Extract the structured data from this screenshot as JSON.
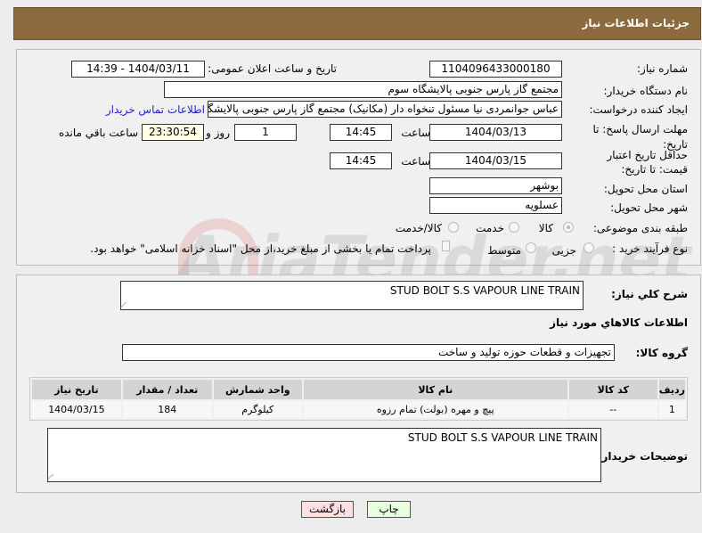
{
  "header": {
    "title": "جزئیات اطلاعات نیاز"
  },
  "form": {
    "need_number_label": "شماره نیاز:",
    "need_number": "1104096433000180",
    "announce_label": "تاریخ و ساعت اعلان عمومی:",
    "announce_value": "1404/03/11 - 14:39",
    "buyer_org_label": "نام دستگاه خریدار:",
    "buyer_org": "مجتمع گاز پارس جنوبی  پالایشگاه سوم",
    "creator_label": "ایجاد کننده درخواست:",
    "creator": "عباس جوانمردی نیا مسئول تنخواه دار  (مکانیک) مجتمع گاز پارس جنوبی  پالایشگاه سوم",
    "contact_link": "اطلاعات تماس خریدار",
    "reply_deadline_label": "مهلت ارسال پاسخ: تا تاریخ:",
    "reply_date": "1404/03/13",
    "time_label": "ساعت",
    "reply_time": "14:45",
    "days": "1",
    "days_label": "روز و",
    "remaining": "23:30:54",
    "remaining_label": "ساعت باقي مانده",
    "validity_label": "حداقل تاریخ اعتبار قیمت: تا تاریخ:",
    "validity_date": "1404/03/15",
    "validity_time": "14:45",
    "province_label": "استان محل تحویل:",
    "province": "بوشهر",
    "city_label": "شهر محل تحویل:",
    "city": "عسلویه",
    "category_label": "طبقه بندی موضوعی:",
    "category_options": [
      "کالا",
      "خدمت",
      "کالا/خدمت"
    ],
    "process_label": "نوع فرآیند خرید :",
    "process_options": [
      "جزیی",
      "متوسط"
    ],
    "payment_note": "پرداخت تمام یا بخشی از مبلغ خرید،از محل \"اسناد خزانه اسلامی\" خواهد بود."
  },
  "details": {
    "summary_label": "شرح کلي نیاز:",
    "summary": "STUD BOLT S.S VAPOUR LINE  TRAIN",
    "goods_info_title": "اطلاعات کالاهاي مورد نیاز",
    "group_label": "گروه کالا:",
    "group": "تجهیزات و قطعات حوزه تولید و ساخت",
    "table": {
      "headers": [
        "ردیف",
        "کد کالا",
        "نام کالا",
        "واحد شمارش",
        "تعداد / مقدار",
        "تاریخ نیاز"
      ],
      "rows": [
        [
          "1",
          "--",
          "پیچ و مهره (بولت) تمام رزوه",
          "کیلوگرم",
          "184",
          "1404/03/15"
        ]
      ]
    },
    "buyer_notes_label": "توضیحات خریدار:",
    "buyer_notes": "STUD BOLT S.S VAPOUR LINE  TRAIN"
  },
  "buttons": {
    "print": "چاپ",
    "back": "بازگشت"
  },
  "watermark": "AriaTender.net"
}
